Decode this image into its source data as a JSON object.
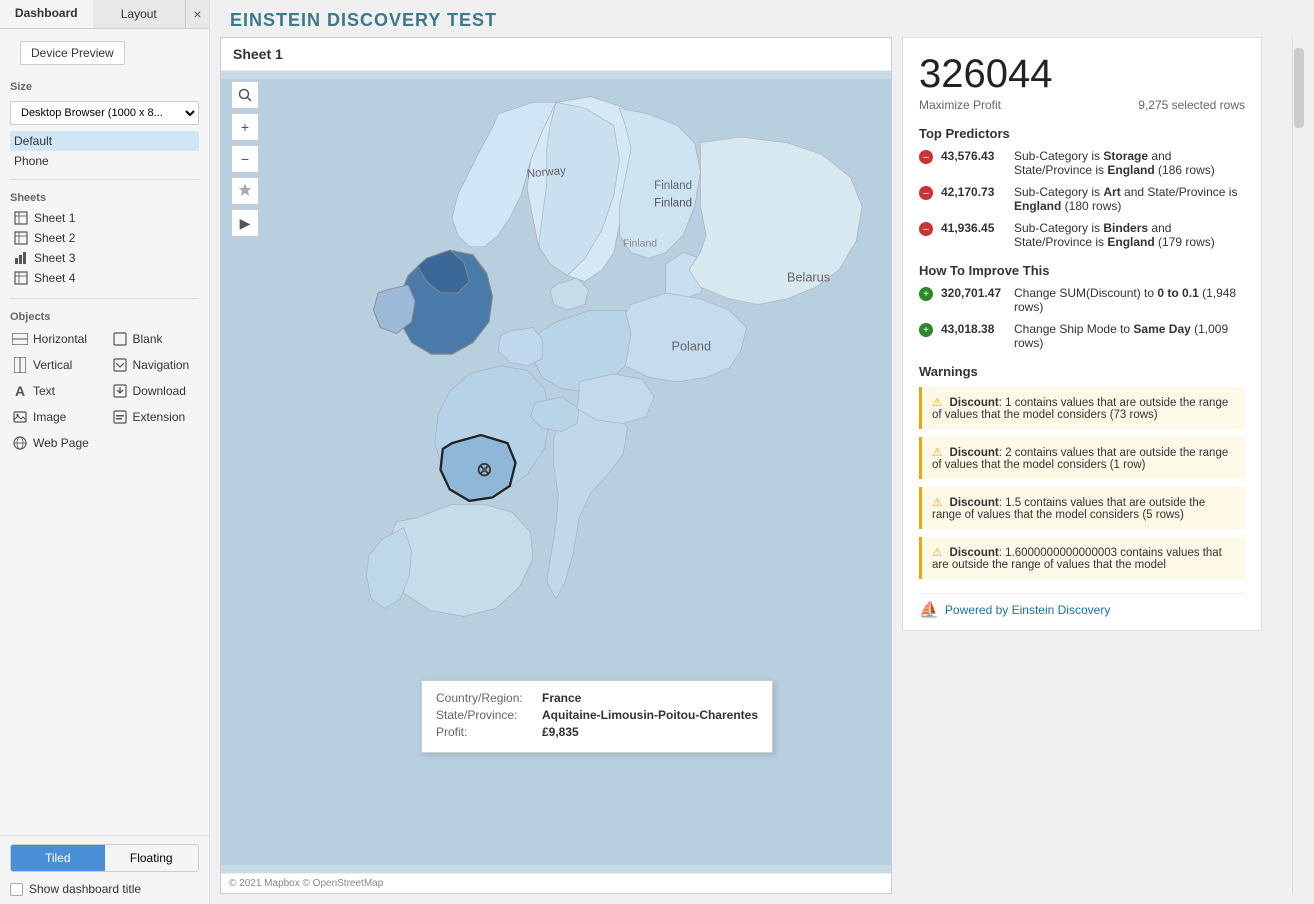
{
  "sidebar": {
    "tab_dashboard": "Dashboard",
    "tab_layout": "Layout",
    "close_icon": "×",
    "device_preview_label": "Device Preview",
    "size_section_label": "Size",
    "size_dropdown_value": "Desktop Browser (1000 x 8...",
    "presets": [
      {
        "label": "Default",
        "selected": true
      },
      {
        "label": "Phone",
        "selected": false
      }
    ],
    "sheets_section_label": "Sheets",
    "sheets": [
      {
        "label": "Sheet 1"
      },
      {
        "label": "Sheet 2"
      },
      {
        "label": "Sheet 3"
      },
      {
        "label": "Sheet 4"
      }
    ],
    "objects_section_label": "Objects",
    "objects": [
      {
        "icon": "H",
        "label": "Horizontal",
        "col": 0
      },
      {
        "icon": "□",
        "label": "Blank",
        "col": 1
      },
      {
        "icon": "V",
        "label": "Vertical",
        "col": 0
      },
      {
        "icon": "↗",
        "label": "Navigation",
        "col": 1
      },
      {
        "icon": "A",
        "label": "Text",
        "col": 0
      },
      {
        "icon": "↓",
        "label": "Download",
        "col": 1
      },
      {
        "icon": "🖼",
        "label": "Image",
        "col": 0
      },
      {
        "icon": "E",
        "label": "Extension",
        "col": 1
      },
      {
        "icon": "🌐",
        "label": "Web Page",
        "col": 0
      }
    ],
    "tiled_label": "Tiled",
    "floating_label": "Floating",
    "show_title_label": "Show dashboard title"
  },
  "dashboard": {
    "title": "EINSTEIN DISCOVERY TEST"
  },
  "map_sheet": {
    "title": "Sheet 1",
    "footer": "© 2021 Mapbox © OpenStreetMap"
  },
  "map_controls": {
    "search": "🔍",
    "zoom_in": "+",
    "zoom_out": "−",
    "pin": "★",
    "play": "▶"
  },
  "map_tooltip": {
    "country_label": "Country/Region:",
    "country_value": "France",
    "state_label": "State/Province:",
    "state_value": "Aquitaine-Limousin-Poitou-Charentes",
    "profit_label": "Profit:",
    "profit_value": "£9,835"
  },
  "einstein": {
    "metric_value": "326044",
    "metric_label": "Maximize Profit",
    "metric_rows": "9,275 selected rows",
    "top_predictors_title": "Top Predictors",
    "predictors": [
      {
        "type": "negative",
        "amount": "43,576.43",
        "desc": "Sub-Category is Storage and State/Province is England (186 rows)"
      },
      {
        "type": "negative",
        "amount": "42,170.73",
        "desc": "Sub-Category is Art and State/Province is England (180 rows)"
      },
      {
        "type": "negative",
        "amount": "41,936.45",
        "desc": "Sub-Category is Binders and State/Province is England (179 rows)"
      }
    ],
    "improve_title": "How To Improve This",
    "improvements": [
      {
        "type": "positive",
        "amount": "320,701.47",
        "desc": "Change SUM(Discount) to 0 to 0.1 (1,948 rows)"
      },
      {
        "type": "positive",
        "amount": "43,018.38",
        "desc": "Change Ship Mode to Same Day (1,009 rows)"
      }
    ],
    "warnings_title": "Warnings",
    "warnings": [
      "Discount: 1 contains values that are outside the range of values that the model considers (73 rows)",
      "Discount: 2 contains values that are outside the range of values that the model considers (1 row)",
      "Discount: 1.5 contains values that are outside the range of values that the model considers (5 rows)",
      "Discount: 1.6000000000000003 contains values that are outside the range of values that the model"
    ],
    "powered_by": "Powered by Einstein Discovery"
  }
}
